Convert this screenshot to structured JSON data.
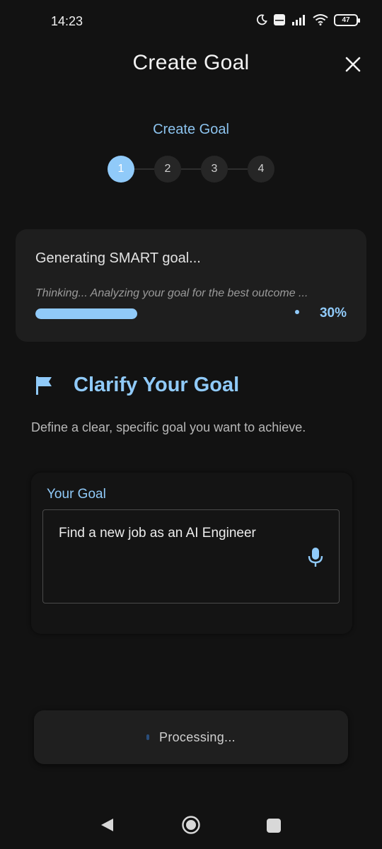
{
  "status_bar": {
    "time": "14:23",
    "battery": "47",
    "icons": [
      "moon-icon",
      "volte-icon",
      "signal-icon",
      "wifi-icon",
      "battery-icon"
    ]
  },
  "header": {
    "title": "Create Goal",
    "close_icon": "close-icon"
  },
  "stepper": {
    "title": "Create Goal",
    "steps": [
      "1",
      "2",
      "3",
      "4"
    ],
    "active_step": 1
  },
  "generating": {
    "title": "Generating SMART goal...",
    "subtitle": "Thinking... Analyzing your goal for the best outcome ...",
    "progress": 0.3,
    "progress_label": "30%"
  },
  "section": {
    "icon": "flag-icon",
    "title": "Clarify Your Goal",
    "description": "Define a clear, specific goal you want to achieve."
  },
  "goal_form": {
    "label": "Your Goal",
    "value": "Find a new job as an AI Engineer",
    "mic_icon": "mic-icon"
  },
  "action": {
    "label": "Processing..."
  },
  "nav": {
    "icons": [
      "back-icon",
      "home-icon",
      "recents-icon"
    ]
  },
  "colors": {
    "background": "#121212",
    "accent": "#90caf9",
    "card": "#1e1e1e"
  }
}
